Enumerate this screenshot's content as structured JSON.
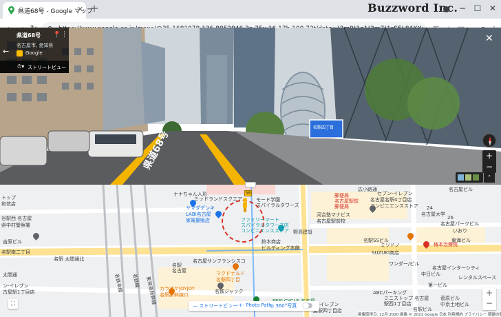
{
  "browser": {
    "tab_title": "県道68号 - Google マップ",
    "new_tab": "+",
    "url": "https://www.google.co.jp/maps/@35.1681078,136.8852846,3a,75y,16.17h,100.73t/data=!3m9!1e1!3m7!1sS5L8AKXce4fTqcJgACzvEQ!2e0!7i16384!8i8192!9m2!1b1!2i45?hl=ja",
    "brand": "Buzzword Inc.",
    "window_min": "−",
    "window_max": "☐",
    "window_close": "✕"
  },
  "streetview": {
    "title": "県道68号",
    "subtitle": "名古屋市, 愛知県",
    "provider": "Google",
    "mode_label": "ストリートビュー",
    "road_marking": "県道68号",
    "sign_text": "名駅四丁目",
    "zoom_in": "+",
    "zoom_out": "−",
    "expand": "⌃",
    "close": "✕"
  },
  "map": {
    "labels": [
      {
        "text": "トップ",
        "cls": "dark"
      },
      {
        "text": "和信店",
        "cls": "dark"
      },
      {
        "text": "谷駅西 名古屋",
        "cls": "dark"
      },
      {
        "text": "県中村警察署",
        "cls": "dark"
      },
      {
        "text": "吉原ビル",
        "cls": "dark"
      },
      {
        "text": "名駅南二丁目",
        "cls": "dark"
      },
      {
        "text": "名駅 太閤通北",
        "cls": "dark"
      },
      {
        "text": "太閤通",
        "cls": "dark"
      },
      {
        "text": "ン-イレブン",
        "cls": "dark"
      },
      {
        "text": "古屋駅1丁目店",
        "cls": "dark"
      },
      {
        "text": "ナナちゃん人形",
        "cls": "dark"
      },
      {
        "text": "ヤマダデンキ",
        "cls": "blue"
      },
      {
        "text": "LABI名古屋",
        "cls": "blue"
      },
      {
        "text": "家電量販店",
        "cls": "blue"
      },
      {
        "text": "ミッドランドスクエア",
        "cls": "dark"
      },
      {
        "text": "モード学園",
        "cls": "dark"
      },
      {
        "text": "スパイラルタワーズ",
        "cls": "dark"
      },
      {
        "text": "ファミリーマート",
        "cls": "teal"
      },
      {
        "text": "スパイラルタワーズ店",
        "cls": "teal"
      },
      {
        "text": "コンビニエンスストア",
        "cls": "teal"
      },
      {
        "text": "河合塾マナビス",
        "cls": "dark"
      },
      {
        "text": "名古屋駅前校",
        "cls": "dark"
      },
      {
        "text": "野島建設",
        "cls": "dark"
      },
      {
        "text": "鈴木商店",
        "cls": "dark"
      },
      {
        "text": "ビルディング本館",
        "cls": "dark"
      },
      {
        "text": "名古屋サンフランシスコ",
        "cls": "dark"
      },
      {
        "text": "マクドナルド",
        "cls": "orange"
      },
      {
        "text": "名駅四丁目",
        "cls": "orange"
      },
      {
        "text": "カラオケJOYJOY",
        "cls": "orange"
      },
      {
        "text": "名駅新幹線口",
        "cls": "orange"
      },
      {
        "text": "名鉄ジャック",
        "cls": "dark"
      },
      {
        "text": "FEELCYCLE 名古屋",
        "cls": "green"
      },
      {
        "text": "ン-イレブン",
        "cls": "dark"
      },
      {
        "text": "屋駅四丁目店",
        "cls": "dark"
      },
      {
        "text": "名駅",
        "cls": "dark"
      },
      {
        "text": "名古屋",
        "cls": "dark"
      },
      {
        "text": "郵便局",
        "cls": "red"
      },
      {
        "text": "名古屋駅前",
        "cls": "red"
      },
      {
        "text": "郵便局",
        "cls": "red"
      },
      {
        "text": "広小路通",
        "cls": "dark"
      },
      {
        "text": "セブン-イレブン",
        "cls": "dark"
      },
      {
        "text": "名古屋名駅4丁目店",
        "cls": "dark"
      },
      {
        "text": "コンビニエンスストア",
        "cls": "dark"
      },
      {
        "text": "名古屋ビル",
        "cls": "dark"
      },
      {
        "text": "東海ビル",
        "cls": "dark"
      },
      {
        "text": "ミソドノ",
        "cls": "dark"
      },
      {
        "text": "名駅SSビル",
        "cls": "dark"
      },
      {
        "text": "SUZUKI商店",
        "cls": "dark"
      },
      {
        "text": "ワンダー/ビル",
        "cls": "dark"
      },
      {
        "text": "ABCパーキング",
        "cls": "dark"
      },
      {
        "text": "ミニストップ 名古屋",
        "cls": "dark"
      },
      {
        "text": "駅西1丁目店",
        "cls": "dark"
      },
      {
        "text": "椿本治療院",
        "cls": "red"
      },
      {
        "text": "名古屋インターシティ",
        "cls": "dark"
      },
      {
        "text": "中日ビル",
        "cls": "dark"
      },
      {
        "text": "第一ビル",
        "cls": "dark"
      },
      {
        "text": "レンタルスペース",
        "cls": "dark"
      },
      {
        "text": "24",
        "cls": "dark"
      },
      {
        "text": "26",
        "cls": "dark"
      },
      {
        "text": "名古屋パークビル",
        "cls": "dark"
      },
      {
        "text": "名古屋大学",
        "cls": "dark"
      },
      {
        "text": "いおり",
        "cls": "dark"
      },
      {
        "text": "菅原ビル",
        "cls": "dark"
      },
      {
        "text": "中京土地ビル",
        "cls": "dark"
      },
      {
        "text": "名駅ビル",
        "cls": "dark"
      },
      {
        "text": "名鉄本線",
        "cls": "dark"
      },
      {
        "text": "名鉄線",
        "cls": "dark"
      },
      {
        "text": "東海道新幹線",
        "cls": "dark"
      }
    ],
    "legend": {
      "streetview": "— ストリートビュー",
      "photo_path": "-+- Photo Path",
      "photo360": "◎ 360°写真"
    },
    "route_number": "58",
    "attribution": "画像取得日: 12月 2020    画像 © 2021 Google    日本    利用規約    プライバシー    問題の報告",
    "zoom_in": "+",
    "zoom_out": "−",
    "handle": "═",
    "mini": "⛶"
  },
  "colors": {
    "tab_strip": "#dee1e6",
    "accent_red": "#d93025",
    "road_yellow": "#f5b400",
    "map_bg": "#f1f3f4"
  }
}
